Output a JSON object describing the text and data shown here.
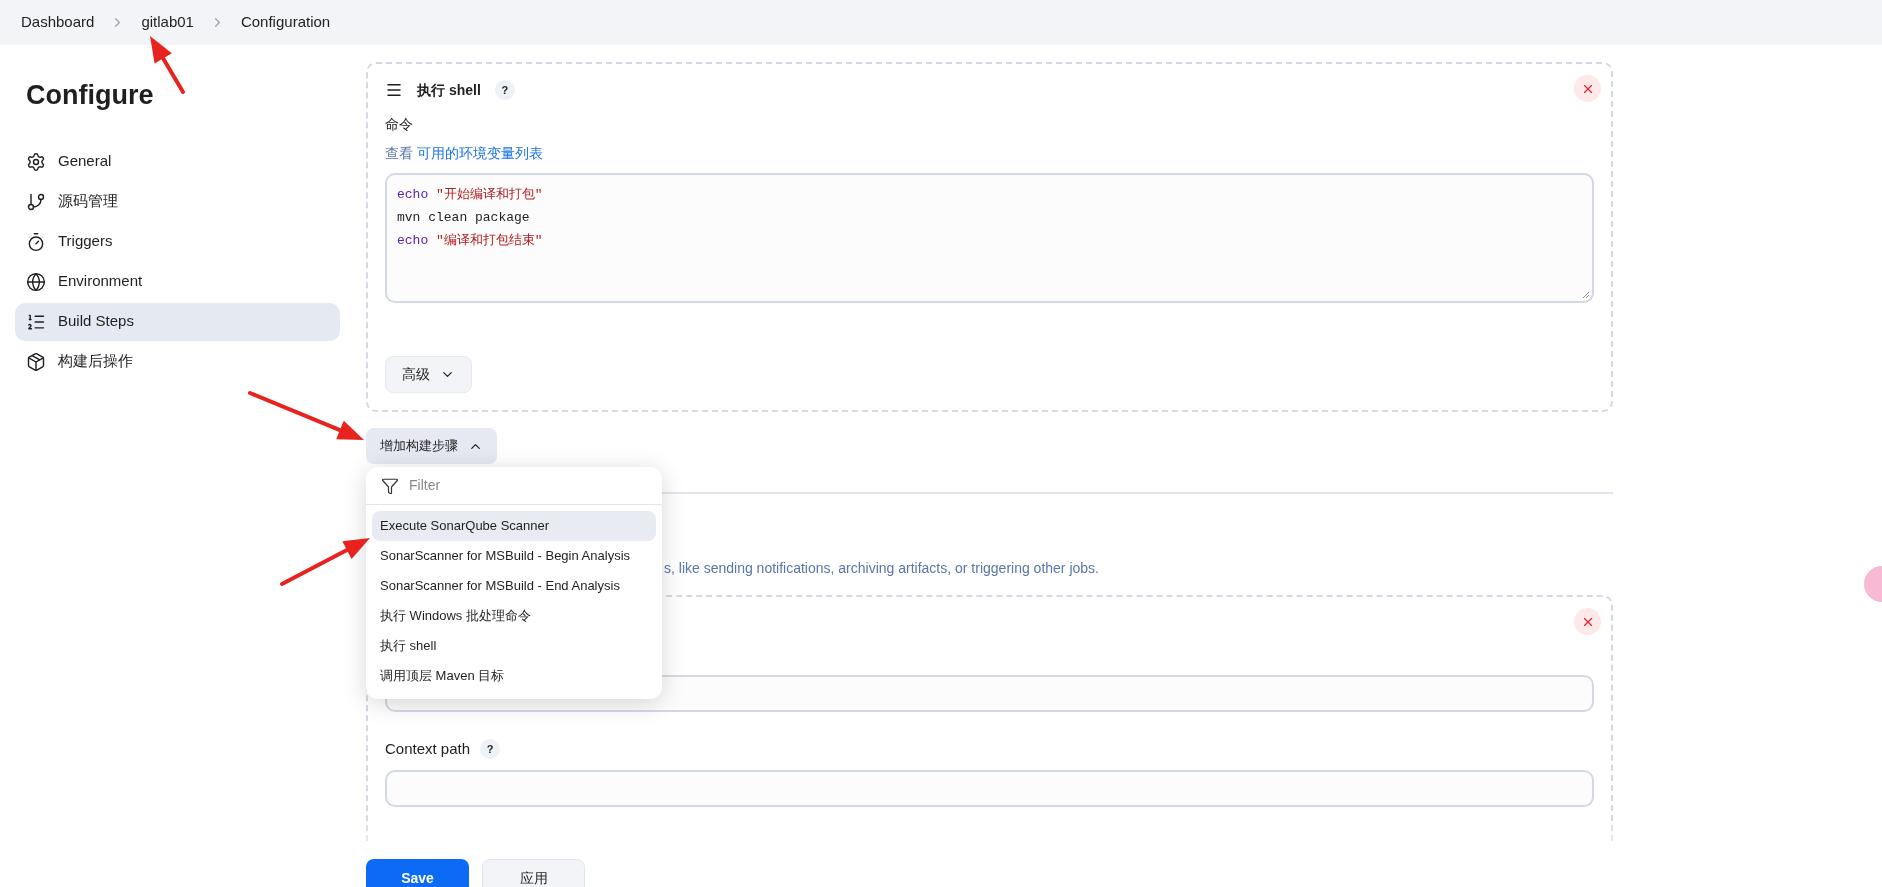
{
  "breadcrumb": [
    {
      "label": "Dashboard"
    },
    {
      "label": "gitlab01"
    },
    {
      "label": "Configuration"
    }
  ],
  "sidebar": {
    "title": "Configure",
    "items": [
      {
        "label": "General",
        "selected": false
      },
      {
        "label": "源码管理",
        "selected": false
      },
      {
        "label": "Triggers",
        "selected": false
      },
      {
        "label": "Environment",
        "selected": false
      },
      {
        "label": "Build Steps",
        "selected": true
      },
      {
        "label": "构建后操作",
        "selected": false
      }
    ]
  },
  "build_step": {
    "title": "执行 shell",
    "help": "?",
    "command_label": "命令",
    "env_prefix": "查看",
    "env_link": "可用的环境变量列表",
    "code": [
      {
        "kind": "echo",
        "keyword": "echo",
        "text": "\"开始编译和打包\""
      },
      {
        "kind": "plain",
        "text": "mvn clean package"
      },
      {
        "kind": "echo",
        "keyword": "echo",
        "text": "\"编译和打包结束\""
      }
    ],
    "advanced_button": "高级"
  },
  "add_step": {
    "label": "增加构建步骤",
    "expanded": true,
    "filter_placeholder": "Filter",
    "items": [
      {
        "label": "Execute SonarQube Scanner",
        "selected": true
      },
      {
        "label": "SonarScanner for MSBuild - Begin Analysis",
        "selected": false
      },
      {
        "label": "SonarScanner for MSBuild - End Analysis",
        "selected": false
      },
      {
        "label": "执行 Windows 批处理命令",
        "selected": false
      },
      {
        "label": "执行 shell",
        "selected": false
      },
      {
        "label": "调用顶层 Maven 目标",
        "selected": false
      }
    ]
  },
  "post_build": {
    "description": "s, like sending notifications, archiving artifacts, or triggering other jobs."
  },
  "deploy_step": {
    "context_path_label": "Context path",
    "help": "?"
  },
  "actions": [
    {
      "kind": "primary",
      "label": "Save"
    },
    {
      "kind": "secondary",
      "label": "应用"
    }
  ]
}
